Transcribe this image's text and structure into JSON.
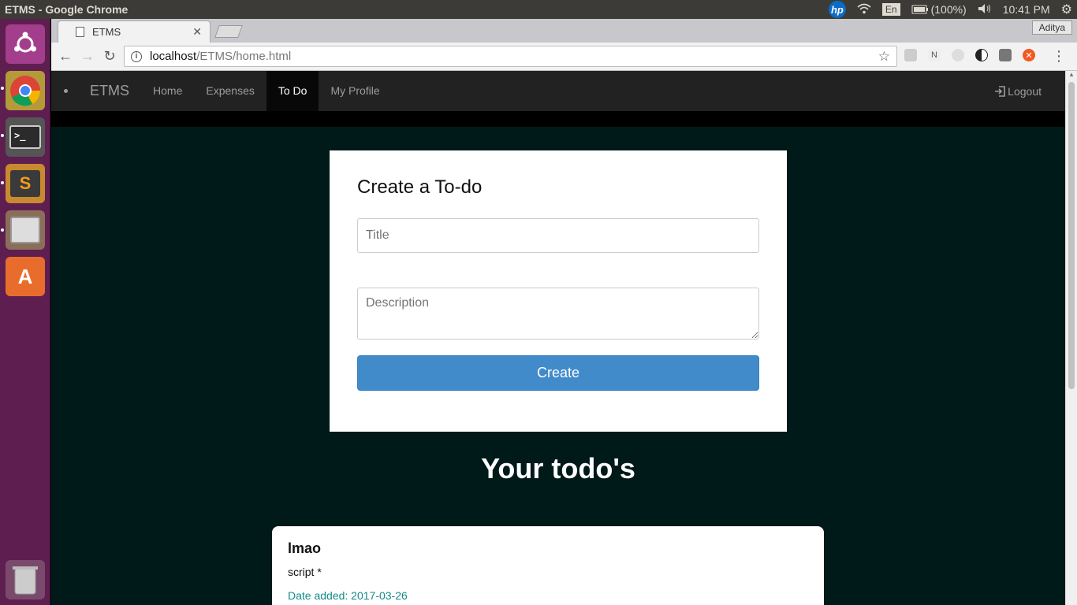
{
  "system": {
    "window_title": "ETMS - Google Chrome",
    "keyboard_layout": "En",
    "battery": "(100%)",
    "clock": "10:41 PM",
    "hp_logo": "hp"
  },
  "launcher": {
    "apps": [
      "ubuntu-icon",
      "chrome-icon",
      "terminal-icon",
      "sublime-text-icon",
      "files-icon",
      "software-center-icon",
      "trash-icon"
    ]
  },
  "browser": {
    "tab_title": "ETMS",
    "profile_name": "Aditya",
    "url_host": "localhost",
    "url_path": "/ETMS/home.html"
  },
  "navbar": {
    "brand": "ETMS",
    "items": [
      {
        "label": "Home",
        "active": false
      },
      {
        "label": "Expenses",
        "active": false
      },
      {
        "label": "To Do",
        "active": true
      },
      {
        "label": "My Profile",
        "active": false
      }
    ],
    "logout_label": "Logout"
  },
  "form": {
    "heading": "Create a To-do",
    "title_placeholder": "Title",
    "description_placeholder": "Description",
    "create_label": "Create"
  },
  "todos": {
    "heading": "Your todo's",
    "items": [
      {
        "title": "lmao",
        "description": "script *",
        "date_label": "Date added: 2017-03-26"
      }
    ]
  },
  "colors": {
    "launcher_bg": "#5e1e4f",
    "navbar_bg": "#222222",
    "page_bg": "#001919",
    "primary_button": "#428bca",
    "date_text": "#138b8b"
  }
}
